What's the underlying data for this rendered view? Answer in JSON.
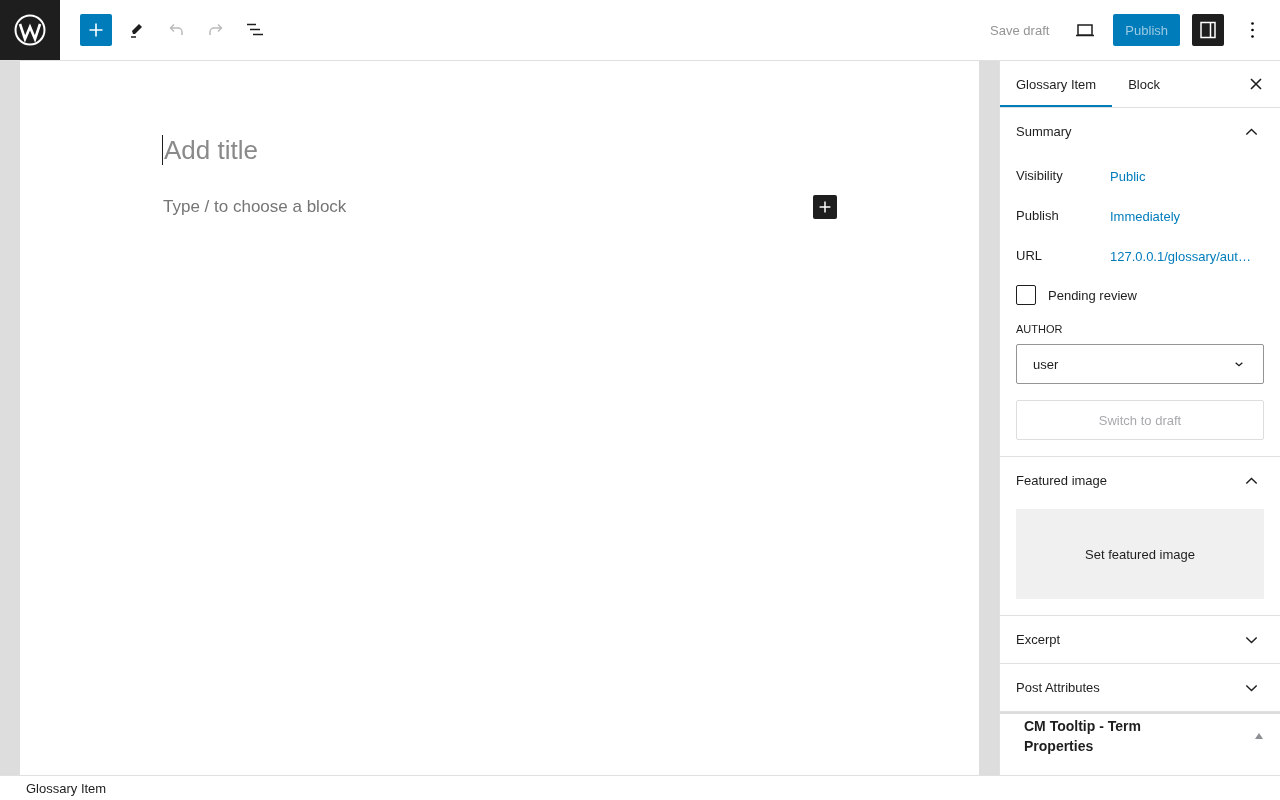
{
  "toolbar": {
    "undo_disabled": true,
    "redo_disabled": true,
    "save_draft": {
      "label": "Save draft",
      "disabled": true
    },
    "publish": {
      "label": "Publish",
      "disabled": true
    },
    "settings_open": true
  },
  "editor": {
    "title_placeholder": "Add title",
    "block_placeholder": "Type / to choose a block"
  },
  "sidebar": {
    "tabs": [
      {
        "label": "Glossary Item",
        "selected": true
      },
      {
        "label": "Block",
        "selected": false
      }
    ],
    "summary": {
      "title": "Summary",
      "expanded": true,
      "rows": [
        {
          "label": "Visibility",
          "value": "Public"
        },
        {
          "label": "Publish",
          "value": "Immediately"
        },
        {
          "label": "URL",
          "value": "127.0.0.1/glossary/aut…"
        }
      ],
      "pending_review": {
        "label": "Pending review",
        "checked": false
      },
      "author": {
        "label": "AUTHOR",
        "value": "user"
      },
      "switch_button": "Switch to draft"
    },
    "featured_image": {
      "title": "Featured image",
      "expanded": true,
      "button": "Set featured image"
    },
    "collapsed_panels": [
      {
        "title": "Excerpt",
        "expanded": false
      },
      {
        "title": "Post Attributes",
        "expanded": false
      }
    ],
    "metabox": {
      "title": "CM Tooltip - Term Properties",
      "expanded": true
    }
  },
  "footer": {
    "breadcrumb": "Glossary Item"
  }
}
